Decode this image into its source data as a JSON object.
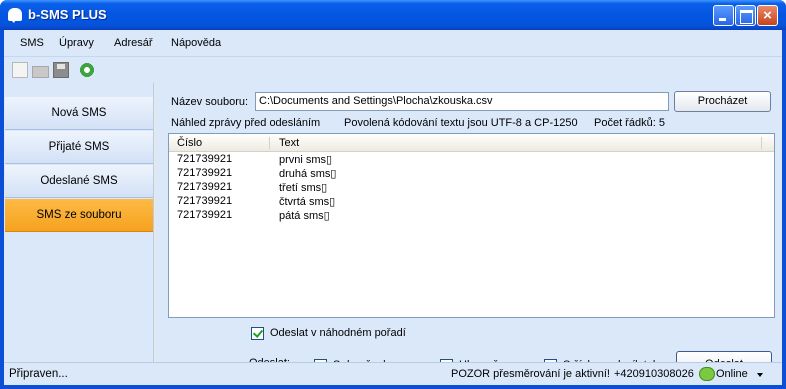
{
  "window": {
    "title": "b-SMS PLUS"
  },
  "menu": [
    "SMS",
    "Úpravy",
    "Adresář",
    "Nápověda"
  ],
  "toolbar": {
    "icons": [
      "new-file-icon",
      "open-folder-icon",
      "save-icon",
      "settings-icon"
    ]
  },
  "sidebar": {
    "items": [
      {
        "label": "Nová SMS"
      },
      {
        "label": "Přijaté SMS"
      },
      {
        "label": "Odeslané SMS"
      },
      {
        "label": "SMS ze souboru",
        "active": true
      }
    ]
  },
  "file": {
    "label": "Název souboru:",
    "value": "C:\\Documents and Settings\\Plocha\\zkouska.csv",
    "browse": "Procházet"
  },
  "info": {
    "preview": "Náhled zprávy před odesláním",
    "encoding": "Povolená kódování textu jsou UTF-8 a CP-1250",
    "row_count": "Počet řádků: 5"
  },
  "table": {
    "columns": [
      "Číslo",
      "Text"
    ],
    "rows": [
      [
        "721739921",
        "prvni sms▯"
      ],
      [
        "721739921",
        "druhá sms▯"
      ],
      [
        "721739921",
        "třetí sms▯"
      ],
      [
        "721739921",
        "čtvrtá sms▯"
      ],
      [
        "721739921",
        "pátá sms▯"
      ]
    ]
  },
  "options": {
    "random_order": {
      "label": "Odeslat v náhodném pořadí",
      "checked": true
    },
    "send_label": "Odeslat:",
    "delivery": {
      "label": "S doručenkou",
      "checked": false
    },
    "voice": {
      "label": "Hlasově",
      "checked": false
    },
    "sender_number": {
      "label": "S číslem odesílatele",
      "checked": false
    },
    "send_button": "Odeslat"
  },
  "status": {
    "left": "Připraven...",
    "warning": "POZOR přesměrování je aktivní!",
    "phone": "+420910308026",
    "online": "Online"
  },
  "colors": {
    "title_bar": "#0456e2",
    "active_tab": "#f6a21f",
    "panel_bg": "#dbe8fa"
  }
}
